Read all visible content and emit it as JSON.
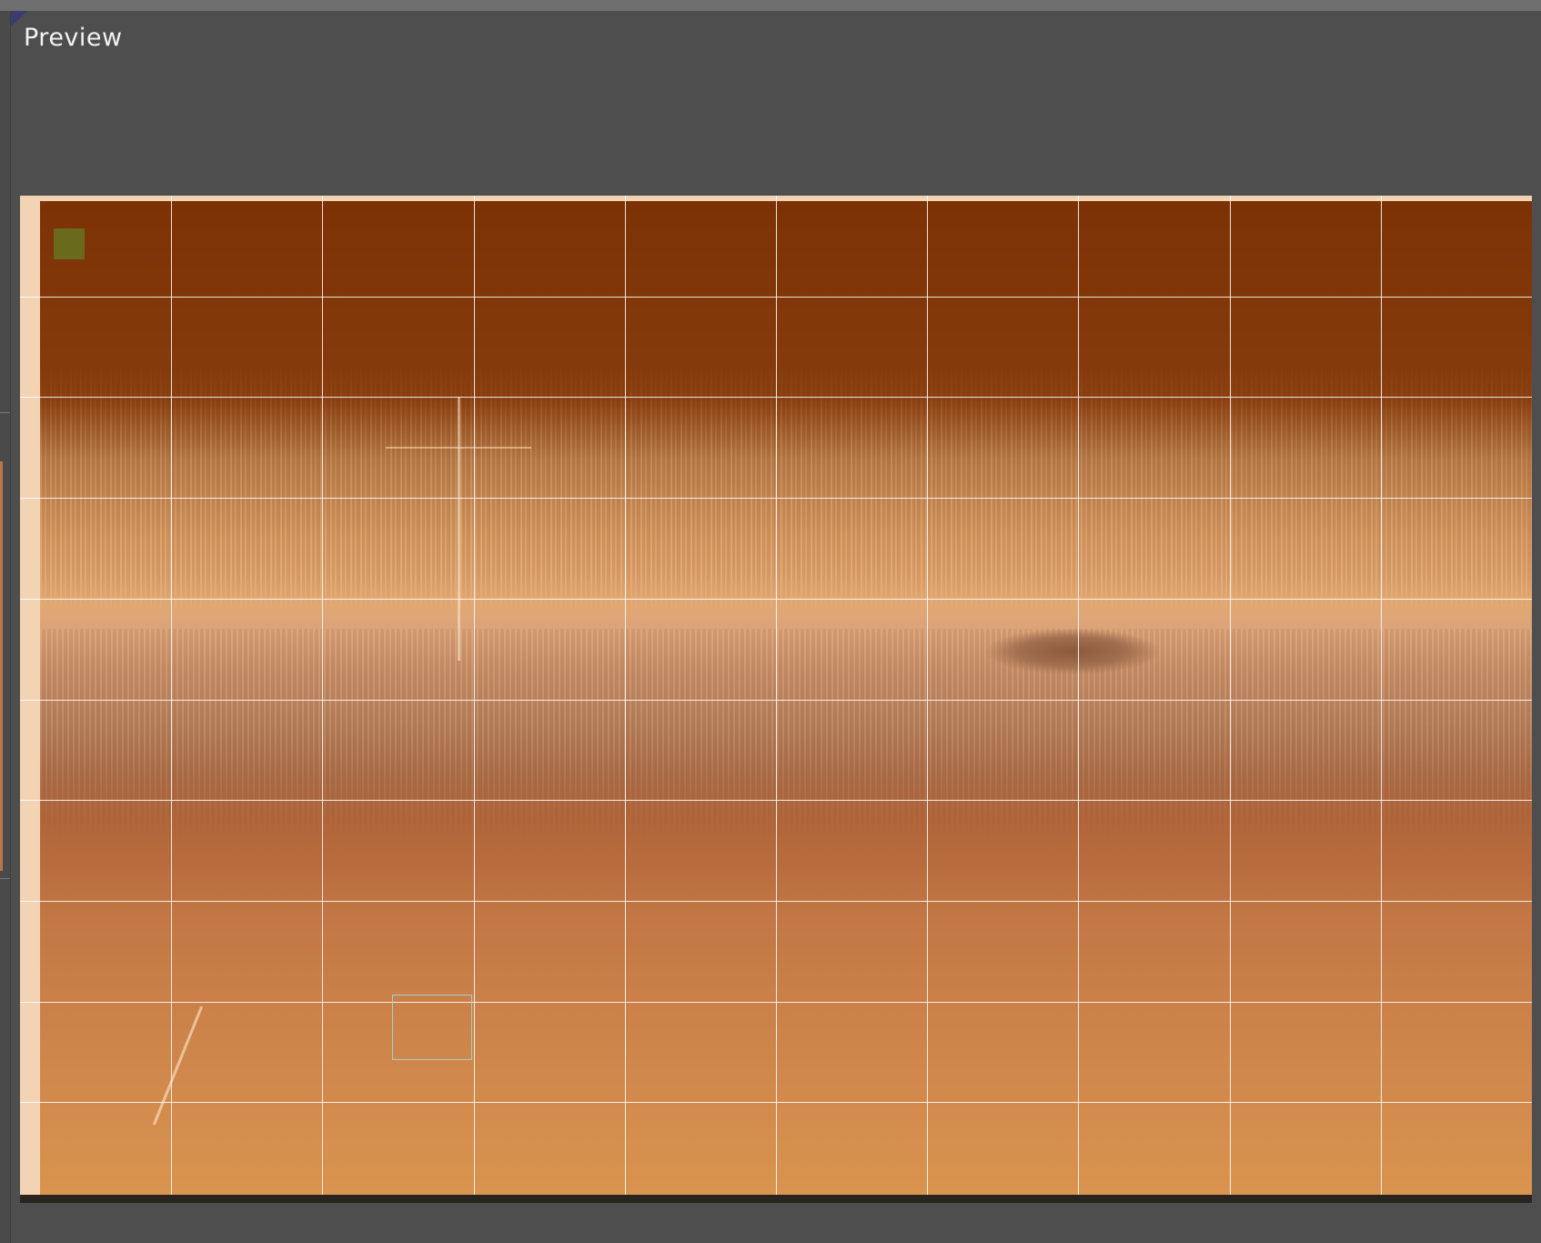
{
  "panel": {
    "title": "Preview"
  },
  "preview": {
    "grid": {
      "columns": 10,
      "rows": 10
    },
    "colors": {
      "background": "#4e4e4e",
      "frame_border": "#f2d3b4",
      "grid_line": "#ffffff",
      "sample_box": "#9fd3cc",
      "color_patch": "#6a6a1c"
    }
  }
}
